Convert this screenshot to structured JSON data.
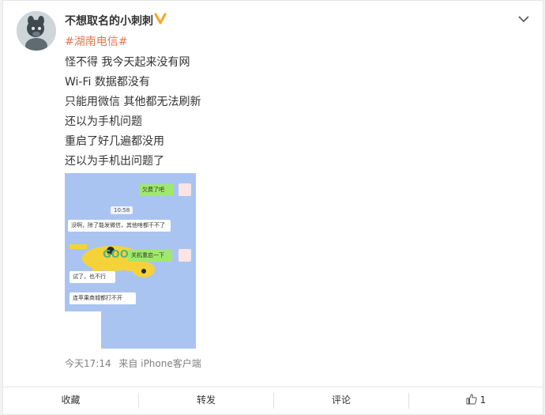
{
  "post": {
    "username": "不想取名的小刺刺",
    "hashtag": "#湖南电信#",
    "lines": [
      "怪不得 我今天起来没有网",
      "Wi-Fi 数据都没有",
      "只能用微信 其他都无法刷新",
      "还以为手机问题",
      "重启了好几遍都没用",
      "还以为手机出问题了"
    ],
    "image_chat": {
      "msg_1": "欠费了吧",
      "time": "10:58",
      "msg_2": "没啊，除了能发微信，其他啥都干不了",
      "msg_3": "关机重启一下",
      "msg_4": "试了，也不行",
      "msg_5": "连苹果商城都打不开",
      "goo_text": "GOO"
    },
    "meta": {
      "time": "今天17:14",
      "source": "来自 iPhone客户端"
    }
  },
  "actions": {
    "collect": "收藏",
    "repost": "转发",
    "comment": "评论",
    "like_count": "1"
  },
  "colors": {
    "hashtag": "#eb7350",
    "badge": "#f5a623",
    "chat_background": "#a9c4f1",
    "green_bubble": "#9fe86c"
  },
  "icons": [
    "avatar-image",
    "verified-badge-icon",
    "chevron-down-icon",
    "thumbs-up-icon"
  ]
}
